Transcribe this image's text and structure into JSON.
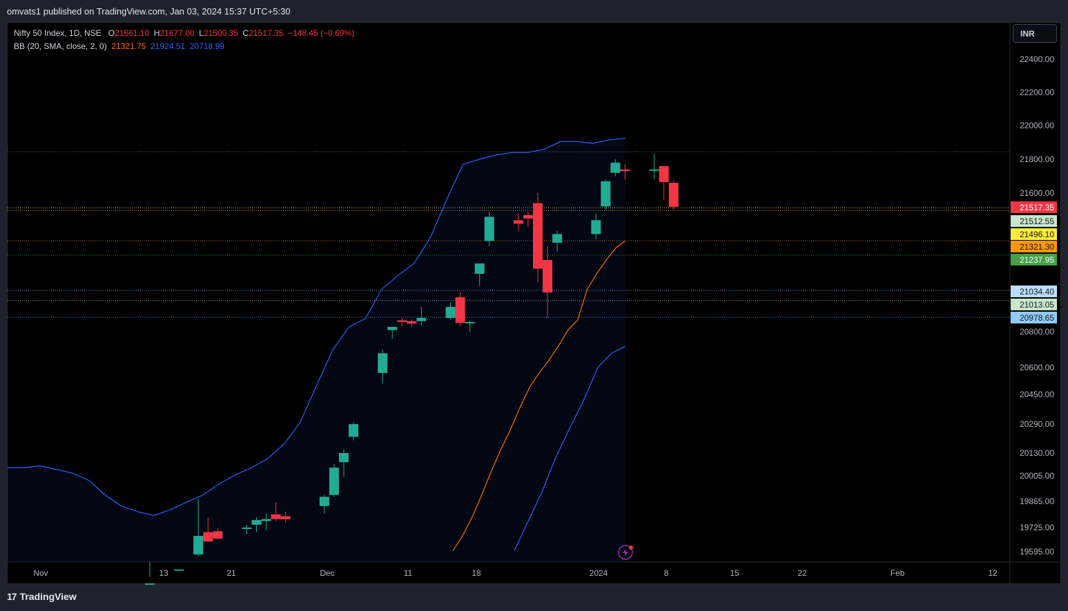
{
  "header": {
    "published": "omvats1 published on TradingView.com, Jan 03, 2024 15:37 UTC+5:30"
  },
  "footer": {
    "brand": "TradingView"
  },
  "currency_button": "INR",
  "legend": {
    "symbol": "Nifty 50 Index, 1D, NSE",
    "o_label": "O",
    "o_value": "21661.10",
    "h_label": "H",
    "h_value": "21677.00",
    "l_label": "L",
    "l_value": "21500.35",
    "c_label": "C",
    "c_value": "21517.35",
    "change": "−148.45 (−0.69%)",
    "bb_label": "BB (20, SMA, close, 2, 0)",
    "bb_basis": "21321.75",
    "bb_upper": "21924.51",
    "bb_lower": "20718.99"
  },
  "colors": {
    "up": "#22ab94",
    "down": "#f23645",
    "upper_band": "#2962ff",
    "basis": "#ff6d00",
    "background": "#000000",
    "frame": "#1e222d"
  },
  "icons": [
    "tradingview-logo-icon",
    "lightning-icon"
  ],
  "chart_data": {
    "type": "candlestick",
    "title": "Nifty 50 Index, 1D, NSE",
    "y_ticks": [
      "22400.00",
      "22200.00",
      "22000.00",
      "21800.00",
      "21600.00",
      "20800.00",
      "20600.00",
      "20450.00",
      "20290.00",
      "20130.00",
      "20005.00",
      "19865.00",
      "19725.00",
      "19595.00"
    ],
    "x_ticks": [
      {
        "label": "Nov",
        "x": 59
      },
      {
        "label": "13",
        "x": 237
      },
      {
        "label": "21",
        "x": 335
      },
      {
        "label": "Dec",
        "x": 474
      },
      {
        "label": "11",
        "x": 591
      },
      {
        "label": "18",
        "x": 690
      },
      {
        "label": "2024",
        "x": 867
      },
      {
        "label": "8",
        "x": 965
      },
      {
        "label": "15",
        "x": 1064
      },
      {
        "label": "22",
        "x": 1162
      },
      {
        "label": "Feb",
        "x": 1300
      },
      {
        "label": "12",
        "x": 1438
      }
    ],
    "price_badges": [
      {
        "value": "21517.35",
        "bg": "#f23645",
        "fg": "#ffffff"
      },
      {
        "value": "21512.55",
        "bg": "#c8e6c9",
        "fg": "#131722"
      },
      {
        "value": "21496.10",
        "bg": "#ffeb3b",
        "fg": "#131722"
      },
      {
        "value": "21321.30",
        "bg": "#ff9800",
        "fg": "#131722"
      },
      {
        "value": "21237.95",
        "bg": "#43a047",
        "fg": "#ffffff"
      },
      {
        "value": "21034.40",
        "bg": "#bbdefb",
        "fg": "#131722"
      },
      {
        "value": "21013.05",
        "bg": "#c8e6c9",
        "fg": "#131722"
      },
      {
        "value": "20978.65",
        "bg": "#90caf9",
        "fg": "#131722"
      }
    ],
    "horizontal_levels": [
      21845.0,
      21512.55,
      21496.1,
      21321.3,
      21237.95,
      21034.4,
      21013.05,
      20978.65
    ],
    "candles": [
      {
        "date": "2023-11-10",
        "o": 19425,
        "h": 19460,
        "l": 19385,
        "c": 19425
      },
      {
        "date": "2023-11-13",
        "o": 19480,
        "h": 19540,
        "l": 19430,
        "c": 19500
      },
      {
        "date": "2023-11-15",
        "o": 19580,
        "h": 19880,
        "l": 19570,
        "c": 19680
      },
      {
        "date": "2023-11-16",
        "o": 19700,
        "h": 19780,
        "l": 19650,
        "c": 19650
      },
      {
        "date": "2023-11-17",
        "o": 19705,
        "h": 19720,
        "l": 19660,
        "c": 19665
      },
      {
        "date": "2023-11-20",
        "o": 19720,
        "h": 19740,
        "l": 19690,
        "c": 19725
      },
      {
        "date": "2023-11-21",
        "o": 19740,
        "h": 19780,
        "l": 19700,
        "c": 19765
      },
      {
        "date": "2023-11-22",
        "o": 19760,
        "h": 19800,
        "l": 19710,
        "c": 19770
      },
      {
        "date": "2023-11-23",
        "o": 19795,
        "h": 19860,
        "l": 19760,
        "c": 19770
      },
      {
        "date": "2023-11-24",
        "o": 19785,
        "h": 19810,
        "l": 19750,
        "c": 19770
      },
      {
        "date": "2023-11-28",
        "o": 19840,
        "h": 19900,
        "l": 19800,
        "c": 19890
      },
      {
        "date": "2023-11-29",
        "o": 19900,
        "h": 20070,
        "l": 19890,
        "c": 20050
      },
      {
        "date": "2023-11-30",
        "o": 20080,
        "h": 20150,
        "l": 20000,
        "c": 20130
      },
      {
        "date": "2023-12-01",
        "o": 20220,
        "h": 20300,
        "l": 20200,
        "c": 20290
      },
      {
        "date": "2023-12-04",
        "o": 20570,
        "h": 20700,
        "l": 20510,
        "c": 20680
      },
      {
        "date": "2023-12-05",
        "o": 20820,
        "h": 20860,
        "l": 20760,
        "c": 20860
      },
      {
        "date": "2023-12-06",
        "o": 20940,
        "h": 20970,
        "l": 20870,
        "c": 20920
      },
      {
        "date": "2023-12-07",
        "o": 20930,
        "h": 20950,
        "l": 20860,
        "c": 20900
      },
      {
        "date": "2023-12-08",
        "o": 20930,
        "h": 21000,
        "l": 20880,
        "c": 20970
      },
      {
        "date": "2023-12-11",
        "o": 20970,
        "h": 21010,
        "l": 20950,
        "c": 21000
      },
      {
        "date": "2023-12-12",
        "o": 21020,
        "h": 21030,
        "l": 20870,
        "c": 20910
      },
      {
        "date": "2023-12-13",
        "o": 20920,
        "h": 20940,
        "l": 20800,
        "c": 20920
      },
      {
        "date": "2023-12-14",
        "o": 21130,
        "h": 21180,
        "l": 21060,
        "c": 21190
      },
      {
        "date": "2023-12-15",
        "o": 21320,
        "h": 21490,
        "l": 21290,
        "c": 21460
      },
      {
        "date": "2023-12-18",
        "o": 21440,
        "h": 21480,
        "l": 21380,
        "c": 21420
      },
      {
        "date": "2023-12-19",
        "o": 21470,
        "h": 21490,
        "l": 21400,
        "c": 21450
      },
      {
        "date": "2023-12-20",
        "o": 21540,
        "h": 21600,
        "l": 21080,
        "c": 21160
      },
      {
        "date": "2023-12-21",
        "o": 21210,
        "h": 21290,
        "l": 20970,
        "c": 21030
      },
      {
        "date": "2023-12-22",
        "o": 21310,
        "h": 21380,
        "l": 21260,
        "c": 21360
      },
      {
        "date": "2023-12-26",
        "o": 21360,
        "h": 21480,
        "l": 21330,
        "c": 21440
      },
      {
        "date": "2023-12-27",
        "o": 21520,
        "h": 21680,
        "l": 21500,
        "c": 21670
      },
      {
        "date": "2023-12-28",
        "o": 21720,
        "h": 21800,
        "l": 21700,
        "c": 21780
      },
      {
        "date": "2023-12-29",
        "o": 21740,
        "h": 21770,
        "l": 21680,
        "c": 21730
      },
      {
        "date": "2024-01-01",
        "o": 21740,
        "h": 21835,
        "l": 21680,
        "c": 21740
      },
      {
        "date": "2024-01-02",
        "o": 21760,
        "h": 21760,
        "l": 21560,
        "c": 21665
      },
      {
        "date": "2024-01-03",
        "o": 21661.1,
        "h": 21677.0,
        "l": 21500.35,
        "c": 21517.35
      }
    ],
    "bollinger": {
      "upper": [
        20050,
        20050,
        20060,
        20040,
        20020,
        19980,
        19900,
        19840,
        19810,
        19790,
        19820,
        19860,
        19900,
        19960,
        20010,
        20050,
        20100,
        20180,
        20300,
        20500,
        20700,
        20860,
        20960,
        21040,
        21120,
        21190,
        21340,
        21560,
        21770,
        21800,
        21825,
        21840,
        21840,
        21860,
        21905,
        21905,
        21895,
        21915,
        21924.51
      ],
      "basis": [
        null,
        null,
        null,
        null,
        null,
        null,
        null,
        null,
        null,
        null,
        null,
        null,
        null,
        null,
        19400,
        19450,
        19520,
        19600,
        19680,
        19780,
        19900,
        20030,
        20150,
        20260,
        20380,
        20490,
        20570,
        20640,
        20720,
        20820,
        20940,
        21040,
        21130,
        21210,
        21280,
        21321.75
      ],
      "lower": [
        null,
        null,
        null,
        null,
        null,
        null,
        null,
        null,
        null,
        null,
        null,
        null,
        null,
        null,
        null,
        null,
        null,
        null,
        null,
        null,
        null,
        null,
        null,
        null,
        null,
        null,
        null,
        null,
        19420,
        19600,
        19760,
        19920,
        20110,
        20270,
        20420,
        20600,
        20680,
        20718.99
      ]
    },
    "grid": false,
    "legend_position": "top-left"
  }
}
